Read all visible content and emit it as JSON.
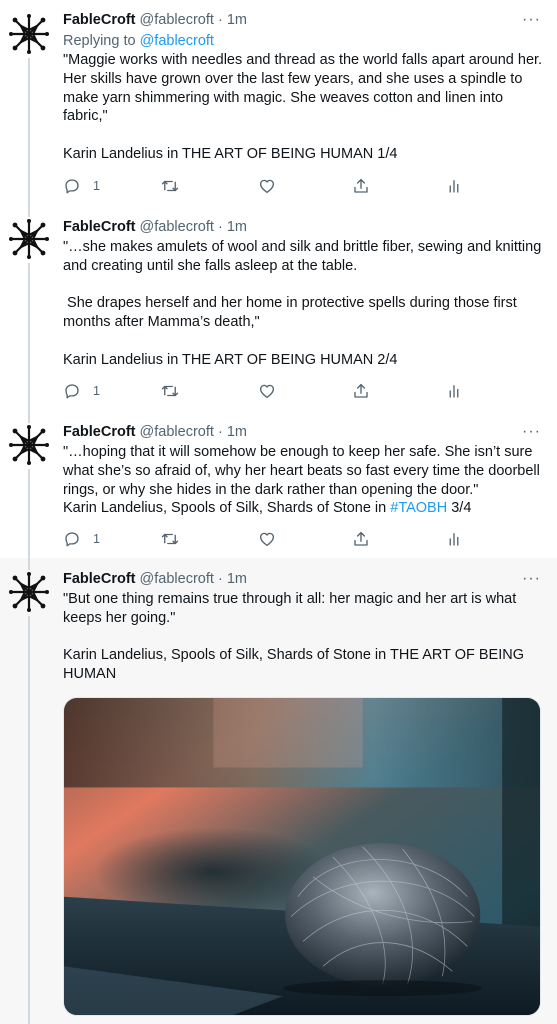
{
  "tweets": [
    {
      "name": "FableCroft",
      "handle": "@fablecroft",
      "dot": "·",
      "time": "1m",
      "reply_prefix": "Replying to",
      "reply_handle": "@fablecroft",
      "paragraphs": [
        "\"Maggie works with needles and thread as the world falls apart around her. Her skills have grown over the last few years, and she uses a spindle to make yarn shimmering with magic. She weaves cotton and linen into fabric,\"",
        "Karin Landelius in THE ART OF BEING HUMAN 1/4"
      ],
      "reply_count": "1"
    },
    {
      "name": "FableCroft",
      "handle": "@fablecroft",
      "dot": "·",
      "time": "1m",
      "paragraphs": [
        "\"…she makes amulets of wool and silk and brittle fiber, sewing and knitting and creating until she falls asleep at the table.",
        " She drapes herself and her home in protective spells during those first months after Mamma’s death,\"",
        "Karin Landelius in THE ART OF BEING HUMAN 2/4"
      ],
      "reply_count": "1"
    },
    {
      "name": "FableCroft",
      "handle": "@fablecroft",
      "dot": "·",
      "time": "1m",
      "line1": "\"…hoping that it will somehow be enough to keep her safe. She isn’t sure what she’s so afraid of, why her heart beats so fast every time the doorbell rings, or why she hides in the dark rather than opening the door.\"",
      "line2_prefix": "Karin Landelius, Spools of Silk, Shards of Stone in ",
      "hashtag": "#TAOBH",
      "line2_suffix": " 3/4",
      "reply_count": "1"
    },
    {
      "name": "FableCroft",
      "handle": "@fablecroft",
      "dot": "·",
      "time": "1m",
      "paragraphs": [
        "\"But one thing remains true through it all: her magic and her art is what keeps her going.\"",
        "Karin Landelius, Spools of Silk, Shards of Stone in THE ART OF BEING HUMAN"
      ]
    }
  ],
  "icons": {
    "avatar": "fablecroft-logo-icon",
    "reply": "reply-icon",
    "retweet": "retweet-icon",
    "like": "heart-icon",
    "share": "share-icon",
    "analytics": "analytics-icon",
    "more": "more-icon"
  },
  "more_glyph": "···",
  "colors": {
    "link": "#1d9bf0",
    "secondary_text": "#536471",
    "thread_line": "#cfd9de",
    "highlight_bg": "#f7f7f7"
  }
}
